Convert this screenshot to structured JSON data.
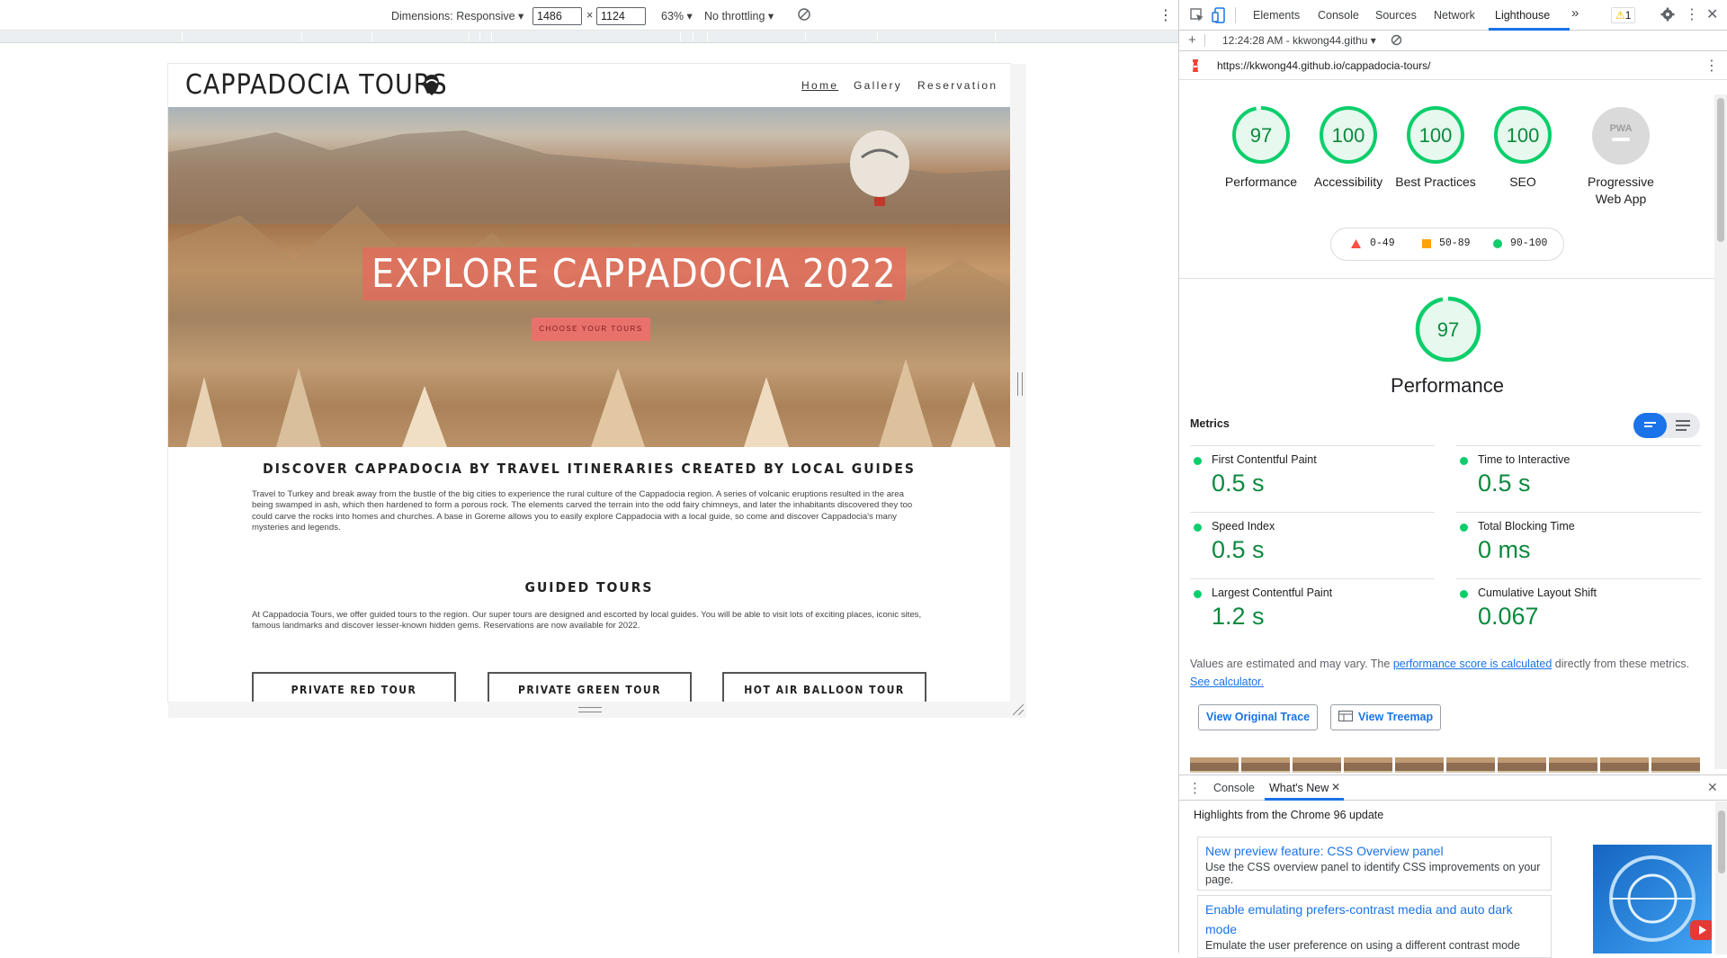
{
  "device_toolbar": {
    "dimensions_label": "Dimensions: Responsive",
    "width": "1486",
    "times": "×",
    "height": "1124",
    "zoom": "63%",
    "throttling": "No throttling"
  },
  "site": {
    "logo": "CAPPADOCIA TOURS",
    "nav": [
      "Home",
      "Gallery",
      "Reservation"
    ],
    "hero_title": "EXPLORE CAPPADOCIA 2022",
    "hero_button": "CHOOSE YOUR TOURS",
    "section1_title": "DISCOVER CAPPADOCIA BY TRAVEL ITINERARIES CREATED BY LOCAL GUIDES",
    "section1_text": "Travel to Turkey and break away from the bustle of the big cities to experience the rural culture of the Cappadocia region. A series of volcanic eruptions resulted in the area being swamped in ash, which then hardened to form a porous rock. The elements carved the terrain into the odd fairy chimneys, and later the inhabitants discovered they too could carve the rocks into homes and churches. A base in Goreme allows you to easily explore Cappadocia with a local guide, so come and discover Cappadocia's many mysteries and legends.",
    "section2_title": "GUIDED TOURS",
    "section2_text": "At Cappadocia Tours, we offer guided tours to the region. Our super tours are designed and escorted by local guides. You will be able to visit lots of exciting places, iconic sites, famous landmarks and discover lesser-known hidden gems. Reservations are now available for 2022.",
    "tours": [
      "PRIVATE RED TOUR",
      "PRIVATE GREEN TOUR",
      "HOT AIR BALLOON TOUR"
    ]
  },
  "devtools": {
    "tabs": [
      "Elements",
      "Console",
      "Sources",
      "Network",
      "Lighthouse"
    ],
    "more_tabs": "»",
    "warning_count": "1",
    "report_time": "12:24:28 AM - kkwong44.githu",
    "url": "https://kkwong44.github.io/cappadocia-tours/"
  },
  "lighthouse": {
    "gauges": [
      {
        "score": "97",
        "label": "Performance"
      },
      {
        "score": "100",
        "label": "Accessibility"
      },
      {
        "score": "100",
        "label": "Best Practices"
      },
      {
        "score": "100",
        "label": "SEO"
      },
      {
        "score": "PWA",
        "label": "Progressive Web App"
      }
    ],
    "legend": [
      {
        "range": "0-49",
        "color": "#ff4e42"
      },
      {
        "range": "50-89",
        "color": "#ffa400"
      },
      {
        "range": "90-100",
        "color": "#0cce6b"
      }
    ],
    "big_score": "97",
    "big_label": "Performance",
    "metrics_heading": "Metrics",
    "metrics": [
      {
        "label": "First Contentful Paint",
        "value": "0.5 s"
      },
      {
        "label": "Time to Interactive",
        "value": "0.5 s"
      },
      {
        "label": "Speed Index",
        "value": "0.5 s"
      },
      {
        "label": "Total Blocking Time",
        "value": "0 ms"
      },
      {
        "label": "Largest Contentful Paint",
        "value": "1.2 s"
      },
      {
        "label": "Cumulative Layout Shift",
        "value": "0.067"
      }
    ],
    "note_prefix": "Values are estimated and may vary. The ",
    "note_link1": "performance score is calculated",
    "note_middle": " directly from these metrics. ",
    "note_link2": "See calculator.",
    "view_trace": "View Original Trace",
    "view_treemap": "View Treemap",
    "pass_color": "#0cce6b"
  },
  "drawer": {
    "tabs": [
      "Console",
      "What's New"
    ],
    "heading": "Highlights from the Chrome 96 update",
    "cards": [
      {
        "title": "New preview feature: CSS Overview panel",
        "desc": "Use the CSS overview panel to identify CSS improvements on your page."
      },
      {
        "title": "Enable emulating prefers-contrast media and auto dark mode",
        "desc": "Emulate the user preference on using a different contrast mode"
      }
    ]
  }
}
